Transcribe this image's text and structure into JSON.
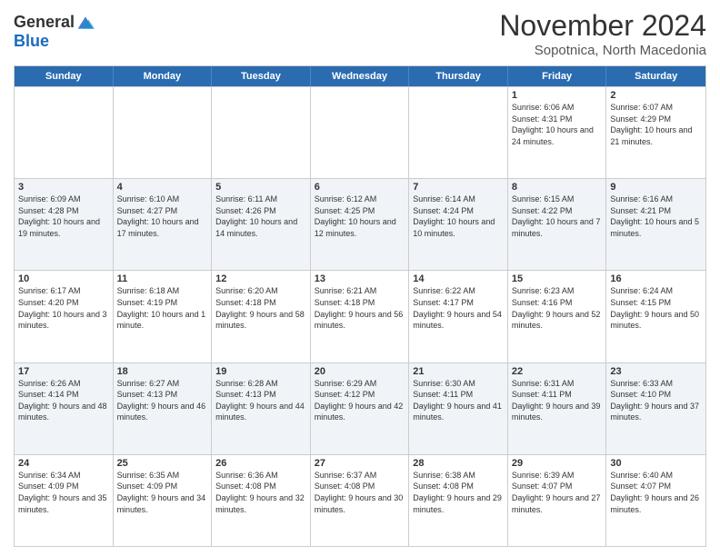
{
  "logo": {
    "line1": "General",
    "line2": "Blue"
  },
  "title": "November 2024",
  "subtitle": "Sopotnica, North Macedonia",
  "days_header": [
    "Sunday",
    "Monday",
    "Tuesday",
    "Wednesday",
    "Thursday",
    "Friday",
    "Saturday"
  ],
  "rows": [
    {
      "shade": false,
      "cells": [
        {
          "day": "",
          "info": ""
        },
        {
          "day": "",
          "info": ""
        },
        {
          "day": "",
          "info": ""
        },
        {
          "day": "",
          "info": ""
        },
        {
          "day": "",
          "info": ""
        },
        {
          "day": "1",
          "info": "Sunrise: 6:06 AM\nSunset: 4:31 PM\nDaylight: 10 hours and 24 minutes."
        },
        {
          "day": "2",
          "info": "Sunrise: 6:07 AM\nSunset: 4:29 PM\nDaylight: 10 hours and 21 minutes."
        }
      ]
    },
    {
      "shade": true,
      "cells": [
        {
          "day": "3",
          "info": "Sunrise: 6:09 AM\nSunset: 4:28 PM\nDaylight: 10 hours and 19 minutes."
        },
        {
          "day": "4",
          "info": "Sunrise: 6:10 AM\nSunset: 4:27 PM\nDaylight: 10 hours and 17 minutes."
        },
        {
          "day": "5",
          "info": "Sunrise: 6:11 AM\nSunset: 4:26 PM\nDaylight: 10 hours and 14 minutes."
        },
        {
          "day": "6",
          "info": "Sunrise: 6:12 AM\nSunset: 4:25 PM\nDaylight: 10 hours and 12 minutes."
        },
        {
          "day": "7",
          "info": "Sunrise: 6:14 AM\nSunset: 4:24 PM\nDaylight: 10 hours and 10 minutes."
        },
        {
          "day": "8",
          "info": "Sunrise: 6:15 AM\nSunset: 4:22 PM\nDaylight: 10 hours and 7 minutes."
        },
        {
          "day": "9",
          "info": "Sunrise: 6:16 AM\nSunset: 4:21 PM\nDaylight: 10 hours and 5 minutes."
        }
      ]
    },
    {
      "shade": false,
      "cells": [
        {
          "day": "10",
          "info": "Sunrise: 6:17 AM\nSunset: 4:20 PM\nDaylight: 10 hours and 3 minutes."
        },
        {
          "day": "11",
          "info": "Sunrise: 6:18 AM\nSunset: 4:19 PM\nDaylight: 10 hours and 1 minute."
        },
        {
          "day": "12",
          "info": "Sunrise: 6:20 AM\nSunset: 4:18 PM\nDaylight: 9 hours and 58 minutes."
        },
        {
          "day": "13",
          "info": "Sunrise: 6:21 AM\nSunset: 4:18 PM\nDaylight: 9 hours and 56 minutes."
        },
        {
          "day": "14",
          "info": "Sunrise: 6:22 AM\nSunset: 4:17 PM\nDaylight: 9 hours and 54 minutes."
        },
        {
          "day": "15",
          "info": "Sunrise: 6:23 AM\nSunset: 4:16 PM\nDaylight: 9 hours and 52 minutes."
        },
        {
          "day": "16",
          "info": "Sunrise: 6:24 AM\nSunset: 4:15 PM\nDaylight: 9 hours and 50 minutes."
        }
      ]
    },
    {
      "shade": true,
      "cells": [
        {
          "day": "17",
          "info": "Sunrise: 6:26 AM\nSunset: 4:14 PM\nDaylight: 9 hours and 48 minutes."
        },
        {
          "day": "18",
          "info": "Sunrise: 6:27 AM\nSunset: 4:13 PM\nDaylight: 9 hours and 46 minutes."
        },
        {
          "day": "19",
          "info": "Sunrise: 6:28 AM\nSunset: 4:13 PM\nDaylight: 9 hours and 44 minutes."
        },
        {
          "day": "20",
          "info": "Sunrise: 6:29 AM\nSunset: 4:12 PM\nDaylight: 9 hours and 42 minutes."
        },
        {
          "day": "21",
          "info": "Sunrise: 6:30 AM\nSunset: 4:11 PM\nDaylight: 9 hours and 41 minutes."
        },
        {
          "day": "22",
          "info": "Sunrise: 6:31 AM\nSunset: 4:11 PM\nDaylight: 9 hours and 39 minutes."
        },
        {
          "day": "23",
          "info": "Sunrise: 6:33 AM\nSunset: 4:10 PM\nDaylight: 9 hours and 37 minutes."
        }
      ]
    },
    {
      "shade": false,
      "cells": [
        {
          "day": "24",
          "info": "Sunrise: 6:34 AM\nSunset: 4:09 PM\nDaylight: 9 hours and 35 minutes."
        },
        {
          "day": "25",
          "info": "Sunrise: 6:35 AM\nSunset: 4:09 PM\nDaylight: 9 hours and 34 minutes."
        },
        {
          "day": "26",
          "info": "Sunrise: 6:36 AM\nSunset: 4:08 PM\nDaylight: 9 hours and 32 minutes."
        },
        {
          "day": "27",
          "info": "Sunrise: 6:37 AM\nSunset: 4:08 PM\nDaylight: 9 hours and 30 minutes."
        },
        {
          "day": "28",
          "info": "Sunrise: 6:38 AM\nSunset: 4:08 PM\nDaylight: 9 hours and 29 minutes."
        },
        {
          "day": "29",
          "info": "Sunrise: 6:39 AM\nSunset: 4:07 PM\nDaylight: 9 hours and 27 minutes."
        },
        {
          "day": "30",
          "info": "Sunrise: 6:40 AM\nSunset: 4:07 PM\nDaylight: 9 hours and 26 minutes."
        }
      ]
    }
  ]
}
